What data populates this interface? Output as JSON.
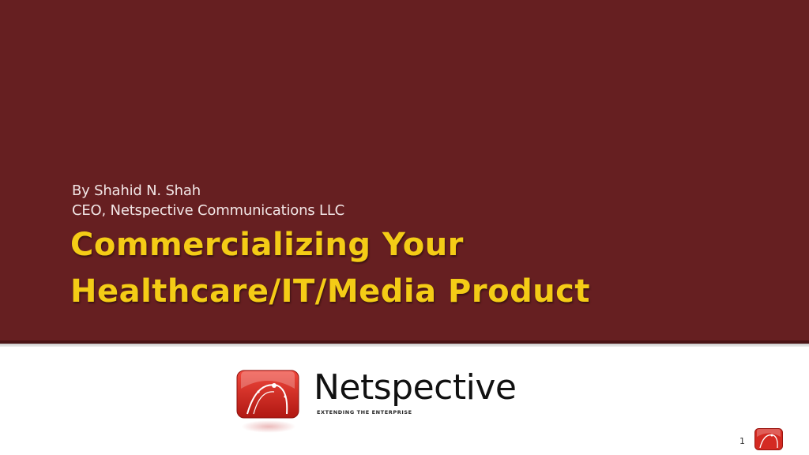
{
  "slide": {
    "subtitle_line1": "By Shahid N. Shah",
    "subtitle_line2": "CEO, Netspective Communications LLC",
    "title_line1": "Commercializing Your",
    "title_line2": "Healthcare/IT/Media Product",
    "page_number": "1"
  },
  "logo": {
    "brand_name": "Netspective",
    "tagline": "EXTENDING THE ENTERPRISE",
    "icon": "netspective-logo-icon"
  },
  "colors": {
    "banner": "#661f21",
    "title": "#f4cc16",
    "subtitle": "#f2e6e6",
    "logo_red": "#d42a22"
  }
}
